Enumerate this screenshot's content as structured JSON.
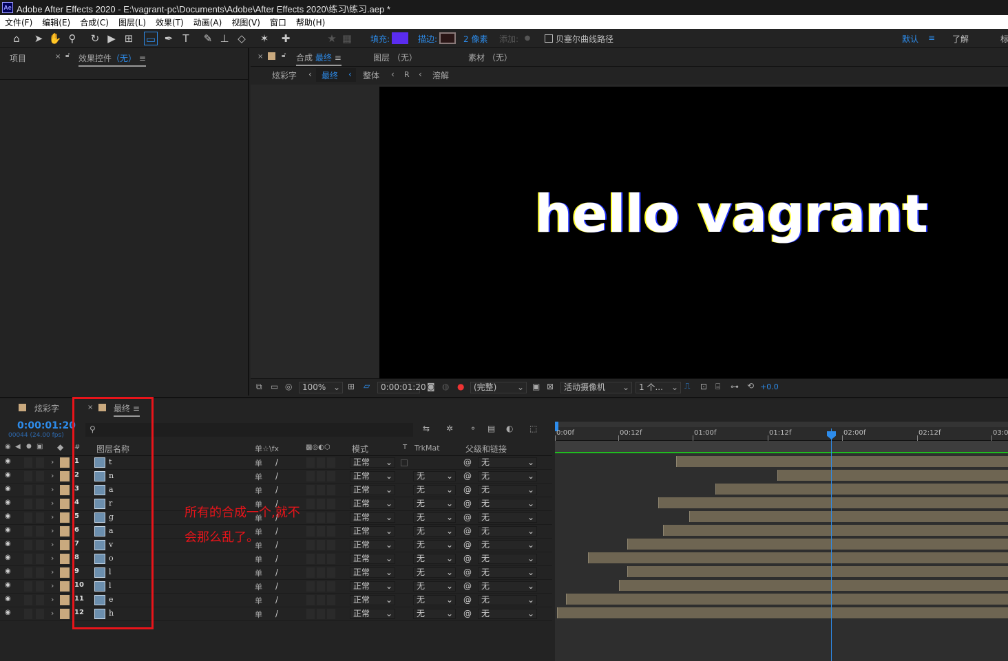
{
  "window": {
    "app_icon": "Ae",
    "title": "Adobe After Effects 2020 - E:\\vagrant-pc\\Documents\\Adobe\\After Effects 2020\\练习\\练习.aep *"
  },
  "menu": [
    "文件(F)",
    "编辑(E)",
    "合成(C)",
    "图层(L)",
    "效果(T)",
    "动画(A)",
    "视图(V)",
    "窗口",
    "帮助(H)"
  ],
  "toolbar": {
    "fill_label": "填充:",
    "stroke_label": "描边:",
    "stroke_width": "2 像素",
    "add_label": "添加:",
    "bezier_label": "贝塞尔曲线路径",
    "workspace_default": "默认",
    "workspace_learn": "了解",
    "workspace_more": "标",
    "fill_color": "#5a2cf0",
    "stroke_color": "#2a1616",
    "accent": "#2d8ceb"
  },
  "left_panel": {
    "tab_project": "项目",
    "tab_effects": "效果控件",
    "tab_effects_state": "（无）"
  },
  "viewer": {
    "comp_tab_prefix": "合成",
    "comp_tab_name": "最终",
    "layer_tab": "图层 （无）",
    "footage_tab": "素材 （无）",
    "breadcrumbs": [
      "炫彩字",
      "最终",
      "整体",
      "R",
      "溶解"
    ],
    "preview_text": "hello vagrant",
    "zoom": "100%",
    "timecode": "0:00:01:20",
    "resolution": "(完整)",
    "camera": "活动摄像机",
    "views": "1 个...",
    "exposure": "+0.0"
  },
  "timeline": {
    "tab_other": "炫彩字",
    "tab_active": "最终",
    "current_time": "0:00:01:20",
    "frame_info": "00044 (24.00 fps)",
    "search_placeholder": "",
    "col_num": "#",
    "col_name": "图层名称",
    "col_switches": "单☆\\fx",
    "col_mode": "模式",
    "col_t": "T",
    "col_trkmat": "TrkMat",
    "col_parent": "父级和链接",
    "ruler_ticks": [
      "0:00f",
      "00:12f",
      "01:00f",
      "01:12f",
      "02:00f",
      "02:12f",
      "03:0"
    ],
    "layers": [
      {
        "num": "1",
        "name": "t",
        "mode": "正常",
        "trkmat": "",
        "parent": "无",
        "start": 0.27
      },
      {
        "num": "2",
        "name": "n",
        "mode": "正常",
        "trkmat": "无",
        "parent": "无",
        "start": 0.5
      },
      {
        "num": "3",
        "name": "a",
        "mode": "正常",
        "trkmat": "无",
        "parent": "无",
        "start": 0.36
      },
      {
        "num": "4",
        "name": "r",
        "mode": "正常",
        "trkmat": "无",
        "parent": "无",
        "start": 0.23
      },
      {
        "num": "5",
        "name": "g",
        "mode": "正常",
        "trkmat": "无",
        "parent": "无",
        "start": 0.3
      },
      {
        "num": "6",
        "name": "a",
        "mode": "正常",
        "trkmat": "无",
        "parent": "无",
        "start": 0.24
      },
      {
        "num": "7",
        "name": "v",
        "mode": "正常",
        "trkmat": "无",
        "parent": "无",
        "start": 0.16
      },
      {
        "num": "8",
        "name": "o",
        "mode": "正常",
        "trkmat": "无",
        "parent": "无",
        "start": 0.07
      },
      {
        "num": "9",
        "name": "l",
        "mode": "正常",
        "trkmat": "无",
        "parent": "无",
        "start": 0.16
      },
      {
        "num": "10",
        "name": "l",
        "mode": "正常",
        "trkmat": "无",
        "parent": "无",
        "start": 0.14
      },
      {
        "num": "11",
        "name": "e",
        "mode": "正常",
        "trkmat": "无",
        "parent": "无",
        "start": 0.02
      },
      {
        "num": "12",
        "name": "h",
        "mode": "正常",
        "trkmat": "无",
        "parent": "无",
        "start": 0.0
      }
    ]
  },
  "annotation": {
    "line1": "所有的合成一个,就不",
    "line2": "会那么乱了。",
    "color": "#e8141a"
  }
}
